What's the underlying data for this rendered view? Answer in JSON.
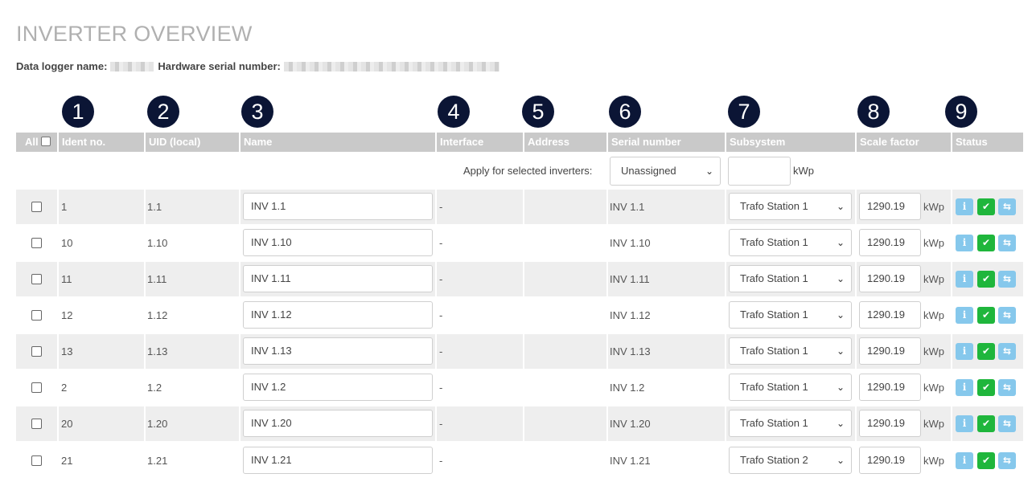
{
  "page": {
    "title": "INVERTER OVERVIEW",
    "logger_label": "Data logger name:",
    "serial_label": "Hardware serial number:"
  },
  "markers": [
    "1",
    "2",
    "3",
    "4",
    "5",
    "6",
    "7",
    "8",
    "9"
  ],
  "columns": {
    "all": "All",
    "ident": "Ident no.",
    "uid": "UID (local)",
    "name": "Name",
    "interface": "Interface",
    "address": "Address",
    "serial": "Serial number",
    "subsystem": "Subsystem",
    "scale": "Scale factor",
    "status": "Status"
  },
  "apply": {
    "label": "Apply for selected inverters:",
    "subsystem_value": "Unassigned",
    "scale_value": "",
    "unit": "kWp"
  },
  "rows": [
    {
      "ident": "1",
      "uid": "1.1",
      "name": "INV 1.1",
      "interface": "-",
      "address": "",
      "serial": "INV 1.1",
      "subsystem": "Trafo Station 1",
      "scale": "1290.19",
      "unit": "kWp"
    },
    {
      "ident": "10",
      "uid": "1.10",
      "name": "INV 1.10",
      "interface": "-",
      "address": "",
      "serial": "INV 1.10",
      "subsystem": "Trafo Station 1",
      "scale": "1290.19",
      "unit": "kWp"
    },
    {
      "ident": "11",
      "uid": "1.11",
      "name": "INV 1.11",
      "interface": "-",
      "address": "",
      "serial": "INV 1.11",
      "subsystem": "Trafo Station 1",
      "scale": "1290.19",
      "unit": "kWp"
    },
    {
      "ident": "12",
      "uid": "1.12",
      "name": "INV 1.12",
      "interface": "-",
      "address": "",
      "serial": "INV 1.12",
      "subsystem": "Trafo Station 1",
      "scale": "1290.19",
      "unit": "kWp"
    },
    {
      "ident": "13",
      "uid": "1.13",
      "name": "INV 1.13",
      "interface": "-",
      "address": "",
      "serial": "INV 1.13",
      "subsystem": "Trafo Station 1",
      "scale": "1290.19",
      "unit": "kWp"
    },
    {
      "ident": "2",
      "uid": "1.2",
      "name": "INV 1.2",
      "interface": "-",
      "address": "",
      "serial": "INV 1.2",
      "subsystem": "Trafo Station 1",
      "scale": "1290.19",
      "unit": "kWp"
    },
    {
      "ident": "20",
      "uid": "1.20",
      "name": "INV 1.20",
      "interface": "-",
      "address": "",
      "serial": "INV 1.20",
      "subsystem": "Trafo Station 1",
      "scale": "1290.19",
      "unit": "kWp"
    },
    {
      "ident": "21",
      "uid": "1.21",
      "name": "INV 1.21",
      "interface": "-",
      "address": "",
      "serial": "INV 1.21",
      "subsystem": "Trafo Station 2",
      "scale": "1290.19",
      "unit": "kWp"
    }
  ],
  "status_icons": [
    "info-icon",
    "check-icon",
    "swap-icon"
  ],
  "colors": {
    "header_bg": "#c9c9c9",
    "marker_bg": "#0b1535",
    "status_ok": "#1fb63c",
    "status_info": "#86c8ec"
  }
}
